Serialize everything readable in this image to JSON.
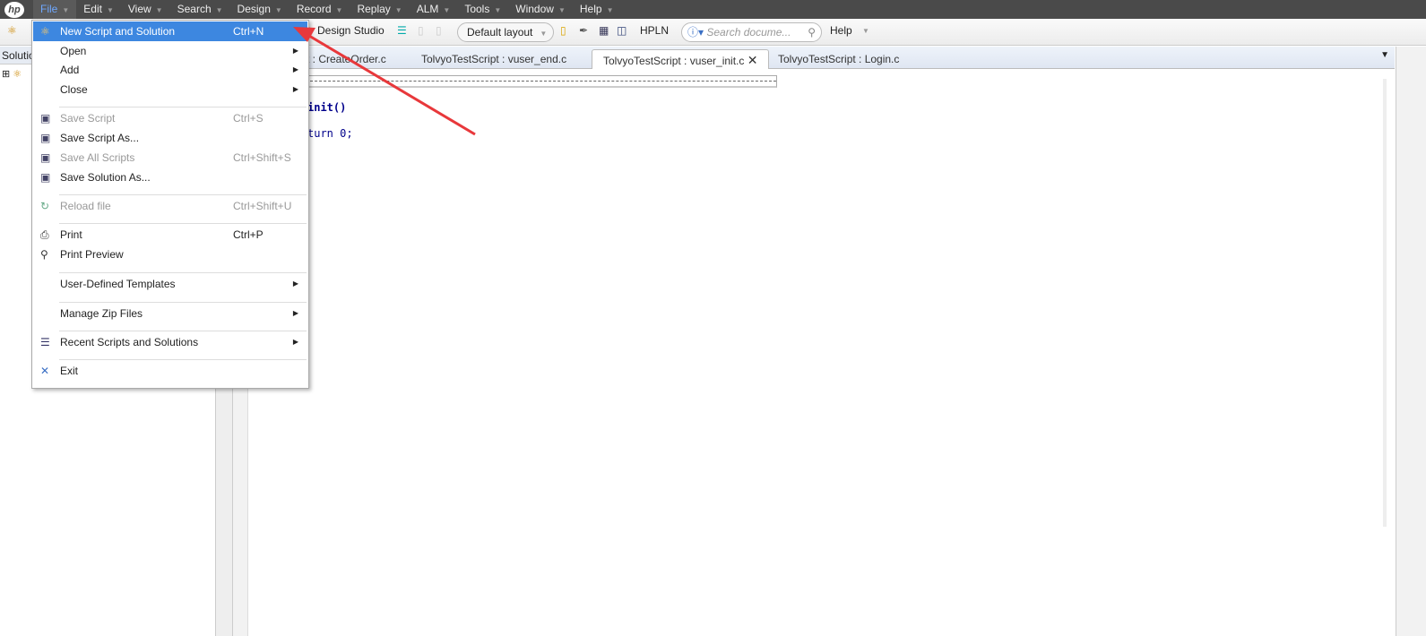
{
  "menubar": {
    "logo": "hp",
    "items": [
      "File",
      "Edit",
      "View",
      "Search",
      "Design",
      "Record",
      "Replay",
      "ALM",
      "Tools",
      "Window",
      "Help"
    ]
  },
  "toolbar": {
    "design_studio": "Design Studio",
    "layout": "Default layout",
    "hpln": "HPLN",
    "search_placeholder": "Search docume...",
    "help": "Help"
  },
  "left_panel": {
    "title": "Solution"
  },
  "tabs": [
    {
      "label": "t : CreateOrder.c"
    },
    {
      "label": "TolvyoTestScript : vuser_end.c"
    },
    {
      "label": "TolvyoTestScript : vuser_init.c",
      "active": true
    },
    {
      "label": "TolvyoTestScript : Login.c"
    }
  ],
  "editor": {
    "lines": [
      "init()",
      "turn 0;"
    ]
  },
  "file_menu": {
    "items": [
      {
        "label": "New Script and Solution",
        "shortcut": "Ctrl+N",
        "highlighted": true,
        "icon": "new-solution-icon"
      },
      {
        "label": "Open",
        "submenu": true
      },
      {
        "label": "Add",
        "submenu": true
      },
      {
        "label": "Close",
        "submenu": true
      },
      {
        "label": "Save Script",
        "shortcut": "Ctrl+S",
        "disabled": true,
        "icon": "save-icon"
      },
      {
        "label": "Save Script As...",
        "icon": "save-as-icon"
      },
      {
        "label": "Save All Scripts",
        "shortcut": "Ctrl+Shift+S",
        "disabled": true,
        "icon": "save-all-icon"
      },
      {
        "label": "Save Solution As...",
        "icon": "save-solution-icon"
      },
      {
        "label": "Reload file",
        "shortcut": "Ctrl+Shift+U",
        "disabled": true,
        "icon": "reload-icon"
      },
      {
        "label": "Print",
        "shortcut": "Ctrl+P",
        "icon": "print-icon"
      },
      {
        "label": "Print Preview",
        "icon": "print-preview-icon"
      },
      {
        "label": "User-Defined Templates",
        "submenu": true
      },
      {
        "label": "Manage Zip Files",
        "submenu": true
      },
      {
        "label": "Recent Scripts and Solutions",
        "submenu": true,
        "icon": "recent-icon"
      },
      {
        "label": "Exit",
        "icon": "exit-icon"
      }
    ]
  },
  "colors": {
    "menubar": "#4a4a4a",
    "highlight": "#3d87e0",
    "annotation_arrow": "#e8383b"
  }
}
